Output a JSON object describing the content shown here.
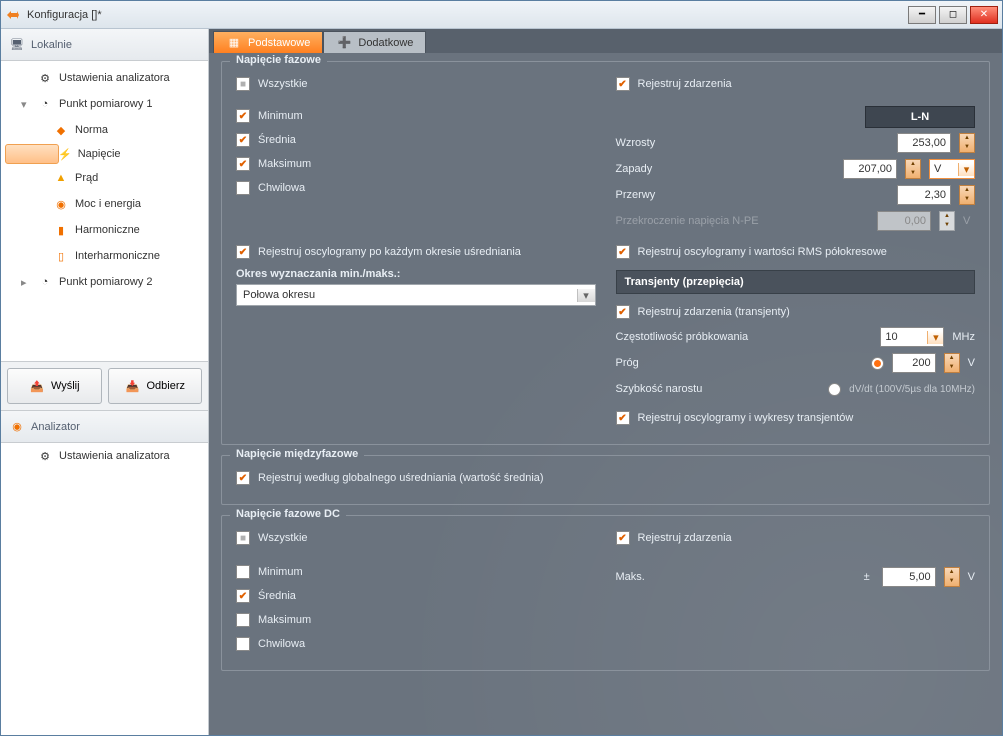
{
  "window": {
    "title": "Konfiguracja []*"
  },
  "sidebar": {
    "local_header": "Lokalnie",
    "analyzer_header": "Analizator",
    "items": {
      "ustawienia": "Ustawienia analizatora",
      "pp1": "Punkt pomiarowy 1",
      "norma": "Norma",
      "napiecie": "Napięcie",
      "prad": "Prąd",
      "moc": "Moc i energia",
      "harmoniczne": "Harmoniczne",
      "interharm": "Interharmoniczne",
      "pp2": "Punkt pomiarowy 2",
      "ustawienia2": "Ustawienia analizatora"
    },
    "buttons": {
      "send": "Wyślij",
      "receive": "Odbierz"
    }
  },
  "tabs": {
    "basic": "Podstawowe",
    "extra": "Dodatkowe"
  },
  "groups": {
    "fazowe": "Napięcie fazowe",
    "miedzy": "Napięcie międzyfazowe",
    "dc": "Napięcie fazowe DC"
  },
  "checks": {
    "wszystkie": "Wszystkie",
    "minimum": "Minimum",
    "srednia": "Średnia",
    "maksimum": "Maksimum",
    "chwilowa": "Chwilowa",
    "rej_osc_usredn": "Rejestruj oscylogramy po każdym okresie uśredniania",
    "okres_lbl": "Okres wyznaczania min./maks.:",
    "rej_zdarzenia": "Rejestruj zdarzenia",
    "rej_osc_rms": "Rejestruj oscylogramy i wartości RMS półokresowe",
    "rej_trans": "Rejestruj zdarzenia (transjenty)",
    "rej_osc_trans": "Rejestruj oscylogramy i wykresy transjentów",
    "rej_global": "Rejestruj według globalnego uśredniania (wartość średnia)"
  },
  "labels": {
    "ln": "L-N",
    "wzrosty": "Wzrosty",
    "zapady": "Zapady",
    "przerwy": "Przerwy",
    "przekroczenie": "Przekroczenie napięcia N-PE",
    "transjenty": "Transjenty (przepięcia)",
    "czest": "Częstotliwość próbkowania",
    "prog": "Próg",
    "szyb": "Szybkość narostu",
    "maks": "Maks.",
    "dvdt": "dV/dt (100V/5µs dla 10MHz)"
  },
  "values": {
    "okres": "Połowa okresu",
    "wzrosty": "253,00",
    "zapady": "207,00",
    "przerwy": "2,30",
    "npe": "0,00",
    "czest": "10",
    "prog": "200",
    "maks": "5,00"
  },
  "units": {
    "v": "V",
    "mhz": "MHz",
    "pm": "±"
  }
}
